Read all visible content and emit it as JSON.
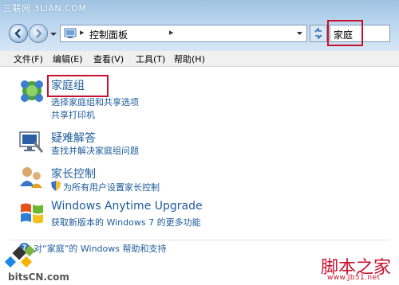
{
  "watermark_top": "三联网 3LIAN.COM",
  "address_bar": {
    "path": "控制面板",
    "chevron": "▸"
  },
  "search": {
    "value": "家庭"
  },
  "menu": [
    "文件(F)",
    "编辑(E)",
    "查看(V)",
    "工具(T)",
    "帮助(H)"
  ],
  "sections": [
    {
      "title": "家庭组",
      "links": [
        "选择家庭组和共享选项",
        "共享打印机"
      ],
      "icon": "homegroup-icon"
    },
    {
      "title": "疑难解答",
      "links": [
        "查找并解决家庭组问题"
      ],
      "icon": "troubleshoot-icon"
    },
    {
      "title": "家长控制",
      "links": [
        "为所有用户设置家长控制"
      ],
      "icon": "parental-controls-icon"
    },
    {
      "title": "Windows Anytime Upgrade",
      "links": [
        "获取新版本的 Windows 7 的更多功能"
      ],
      "icon": "windows-flag-icon"
    }
  ],
  "help_link": "对“家庭”的 Windows 帮助和支持",
  "watermarks": {
    "left": "bitsCN.com",
    "right_title": "脚本之家",
    "right_url": "www.Jb51.net"
  },
  "colors": {
    "link": "#1e5b9c",
    "highlight": "#c8102e",
    "menubar": "#f0f0f0"
  }
}
